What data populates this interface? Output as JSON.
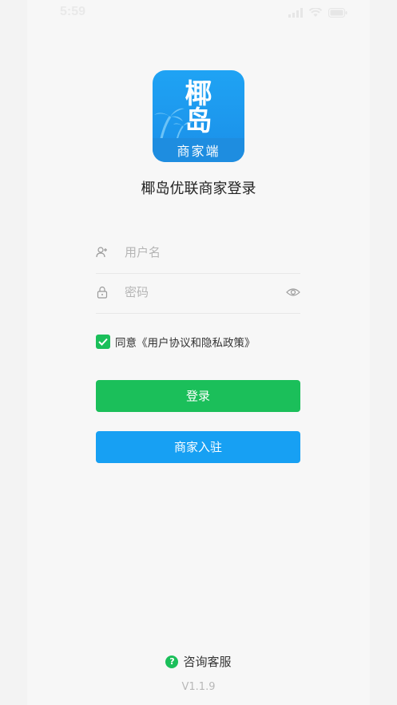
{
  "status_bar": {
    "time": "5:59"
  },
  "logo": {
    "line1": "椰",
    "line2": "岛",
    "subtitle": "商家端",
    "brand_color": "#1fa3f4"
  },
  "title": "椰岛优联商家登录",
  "form": {
    "username_placeholder": "用户名",
    "password_placeholder": "密码",
    "agreement_checked": true,
    "agreement_text": "同意《用户协议和隐私政策》"
  },
  "buttons": {
    "login_label": "登录",
    "login_color": "#1bbf5a",
    "register_label": "商家入驻",
    "register_color": "#17a0f3"
  },
  "footer": {
    "support_label": "咨询客服",
    "support_icon_glyph": "?",
    "version": "V1.1.9"
  },
  "icons": {
    "username": "user-add-icon",
    "password": "lock-icon",
    "show_password": "eye-icon",
    "checkbox": "check-icon",
    "support": "help-circle-icon"
  }
}
